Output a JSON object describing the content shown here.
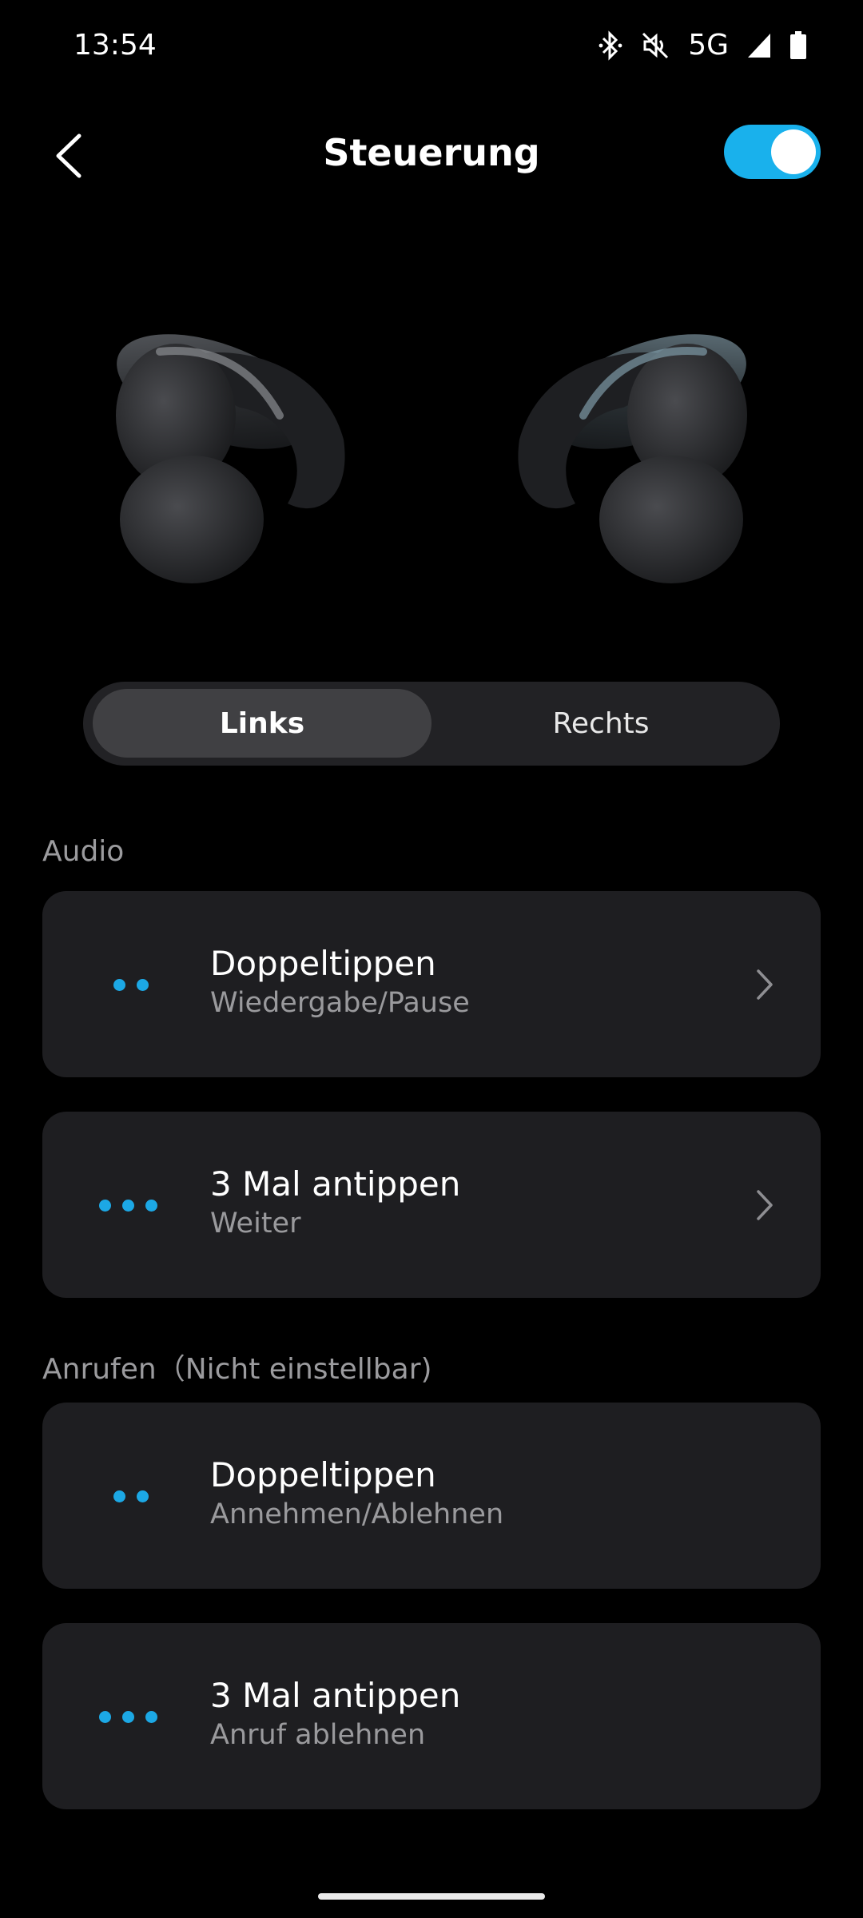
{
  "status_bar": {
    "time": "13:54",
    "network": "5G",
    "icons": [
      "bluetooth-icon",
      "mute-icon",
      "signal-icon",
      "battery-icon"
    ]
  },
  "header": {
    "title": "Steuerung",
    "toggle_on": true,
    "accent": "#19b1ec"
  },
  "segments": {
    "left": "Links",
    "right": "Rechts",
    "selected": "left"
  },
  "audio_section": {
    "label": "Audio",
    "items": [
      {
        "title": "Doppeltippen",
        "subtitle": "Wiedergabe/Pause",
        "dots": 2
      },
      {
        "title": "3 Mal antippen",
        "subtitle": "Weiter",
        "dots": 3
      }
    ]
  },
  "calls_section": {
    "label": "Anrufen（Nicht einstellbar)",
    "items": [
      {
        "title": "Doppeltippen",
        "subtitle": "Annehmen/Ablehnen",
        "dots": 2
      },
      {
        "title": "3 Mal antippen",
        "subtitle": "Anruf ablehnen",
        "dots": 3
      }
    ]
  }
}
